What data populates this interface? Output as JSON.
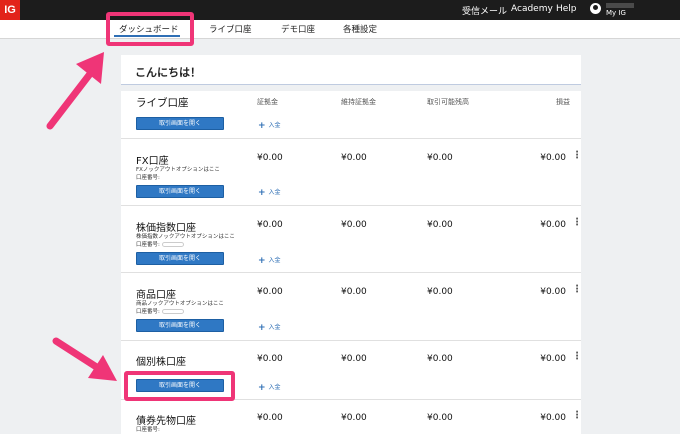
{
  "topbar": {
    "logo": "IG",
    "links": [
      "受信メール",
      "Academy",
      "Help"
    ],
    "user_name": "My IG"
  },
  "nav": {
    "items": [
      "ダッシュボード",
      "ライブ口座",
      "デモ口座",
      "各種設定"
    ],
    "active_index": 0
  },
  "greeting": "こんにちは！",
  "accounts": {
    "section_title": "ライブ口座",
    "columns": [
      "証拠金",
      "維持証拠金",
      "取引可能残高",
      "損益"
    ],
    "open_label": "取引画面を開く",
    "deposit_label": "入金",
    "rows": [
      {
        "title": "FX口座",
        "subtitle": "FXノックアウトオプションはここ",
        "account_no_label": "口座番号:",
        "values": [
          "¥0.00",
          "¥0.00",
          "¥0.00",
          "¥0.00"
        ]
      },
      {
        "title": "株価指数口座",
        "subtitle": "株価指数ノックアウトオプションはここ",
        "account_no_label": "口座番号:",
        "values": [
          "¥0.00",
          "¥0.00",
          "¥0.00",
          "¥0.00"
        ]
      },
      {
        "title": "商品口座",
        "subtitle": "商品ノックアウトオプションはここ",
        "account_no_label": "口座番号:",
        "values": [
          "¥0.00",
          "¥0.00",
          "¥0.00",
          "¥0.00"
        ]
      },
      {
        "title": "個別株口座",
        "subtitle": "",
        "account_no_label": "",
        "values": [
          "¥0.00",
          "¥0.00",
          "¥0.00",
          "¥0.00"
        ]
      },
      {
        "title": "債券先物口座",
        "subtitle": "",
        "account_no_label": "口座番号:",
        "values": [
          "¥0.00",
          "¥0.00",
          "¥0.00",
          "¥0.00"
        ]
      }
    ]
  },
  "annotation": {
    "color": "#ef3577"
  }
}
